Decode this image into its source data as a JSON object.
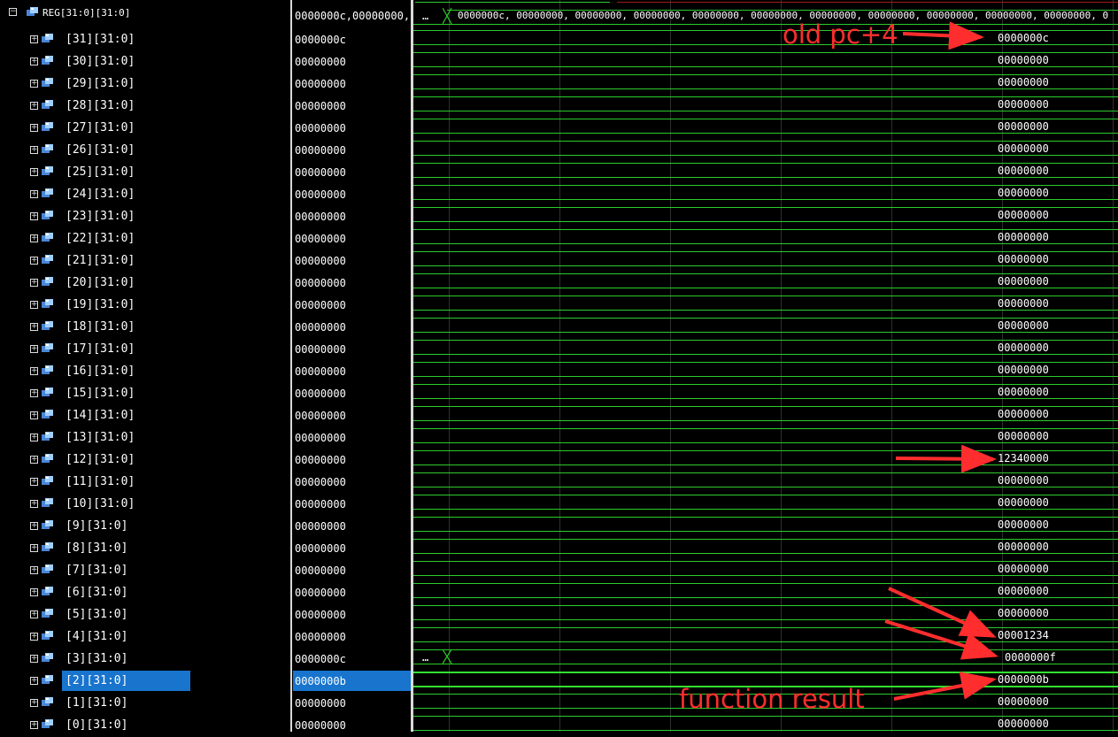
{
  "signals": {
    "top": {
      "label": "REG[31:0][31:0]",
      "value": "0000000c,00000000,",
      "bus_value": "0000000c, 00000000, 00000000, 00000000, 00000000, 00000000, 00000000, 00000000, 00000000, 00000000, 00000000, 0",
      "prev_marker": "…"
    },
    "rows": [
      {
        "label": "[31][31:0]",
        "value": "0000000c",
        "wave_value": "0000000c"
      },
      {
        "label": "[30][31:0]",
        "value": "00000000",
        "wave_value": "00000000"
      },
      {
        "label": "[29][31:0]",
        "value": "00000000",
        "wave_value": "00000000"
      },
      {
        "label": "[28][31:0]",
        "value": "00000000",
        "wave_value": "00000000"
      },
      {
        "label": "[27][31:0]",
        "value": "00000000",
        "wave_value": "00000000"
      },
      {
        "label": "[26][31:0]",
        "value": "00000000",
        "wave_value": "00000000"
      },
      {
        "label": "[25][31:0]",
        "value": "00000000",
        "wave_value": "00000000"
      },
      {
        "label": "[24][31:0]",
        "value": "00000000",
        "wave_value": "00000000"
      },
      {
        "label": "[23][31:0]",
        "value": "00000000",
        "wave_value": "00000000"
      },
      {
        "label": "[22][31:0]",
        "value": "00000000",
        "wave_value": "00000000"
      },
      {
        "label": "[21][31:0]",
        "value": "00000000",
        "wave_value": "00000000"
      },
      {
        "label": "[20][31:0]",
        "value": "00000000",
        "wave_value": "00000000"
      },
      {
        "label": "[19][31:0]",
        "value": "00000000",
        "wave_value": "00000000"
      },
      {
        "label": "[18][31:0]",
        "value": "00000000",
        "wave_value": "00000000"
      },
      {
        "label": "[17][31:0]",
        "value": "00000000",
        "wave_value": "00000000"
      },
      {
        "label": "[16][31:0]",
        "value": "00000000",
        "wave_value": "00000000"
      },
      {
        "label": "[15][31:0]",
        "value": "00000000",
        "wave_value": "00000000"
      },
      {
        "label": "[14][31:0]",
        "value": "00000000",
        "wave_value": "00000000"
      },
      {
        "label": "[13][31:0]",
        "value": "00000000",
        "wave_value": "00000000"
      },
      {
        "label": "[12][31:0]",
        "value": "00000000",
        "wave_value": "12340000"
      },
      {
        "label": "[11][31:0]",
        "value": "00000000",
        "wave_value": "00000000"
      },
      {
        "label": "[10][31:0]",
        "value": "00000000",
        "wave_value": "00000000"
      },
      {
        "label": "[9][31:0]",
        "value": "00000000",
        "wave_value": "00000000"
      },
      {
        "label": "[8][31:0]",
        "value": "00000000",
        "wave_value": "00000000"
      },
      {
        "label": "[7][31:0]",
        "value": "00000000",
        "wave_value": "00000000"
      },
      {
        "label": "[6][31:0]",
        "value": "00000000",
        "wave_value": "00000000"
      },
      {
        "label": "[5][31:0]",
        "value": "00000000",
        "wave_value": "00000000"
      },
      {
        "label": "[4][31:0]",
        "value": "00000000",
        "wave_value": "00001234"
      },
      {
        "label": "[3][31:0]",
        "value": "0000000c",
        "wave_value": "0000000f",
        "prev_marker": "…"
      },
      {
        "label": "[2][31:0]",
        "value": "0000000b",
        "wave_value": "0000000b",
        "selected": true
      },
      {
        "label": "[1][31:0]",
        "value": "00000000",
        "wave_value": "00000000"
      },
      {
        "label": "[0][31:0]",
        "value": "00000000",
        "wave_value": "00000000"
      }
    ]
  },
  "annotations": {
    "old_pc": "old pc+4",
    "function_result": "function result"
  },
  "colors": {
    "wave": "#2ccc2c",
    "selection": "#1874cd",
    "annotation": "#ff2d2d"
  }
}
